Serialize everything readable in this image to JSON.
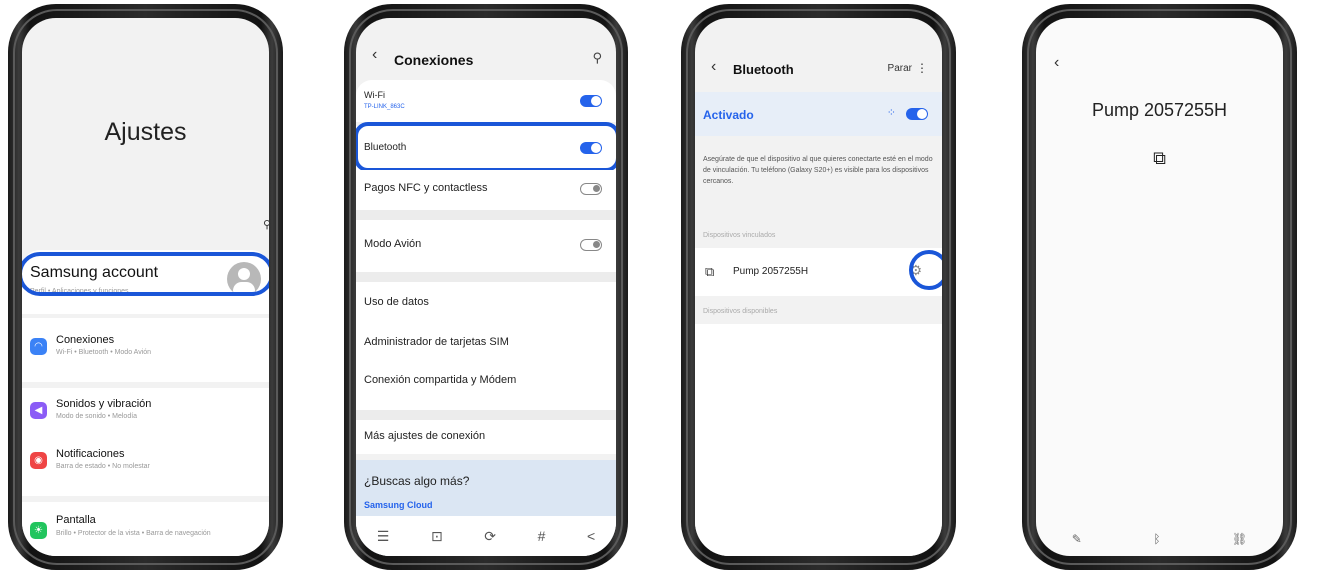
{
  "phone1": {
    "title": "Ajustes",
    "account": {
      "name": "Samsung account",
      "sub": "Perfil • Aplicaciones y funciones"
    },
    "items": [
      {
        "label": "Conexiones",
        "sub": "Wi-Fi • Bluetooth • Modo Avión",
        "color": "#3b82f6",
        "icon": "wifi-icon"
      },
      {
        "label": "Sonidos y vibración",
        "sub": "Modo de sonido • Melodía",
        "color": "#8b5cf6",
        "icon": "speaker-icon"
      },
      {
        "label": "Notificaciones",
        "sub": "Barra de estado • No molestar",
        "color": "#ef4444",
        "icon": "bell-icon"
      },
      {
        "label": "Pantalla",
        "sub": "Brillo • Protector de la vista • Barra de navegación",
        "color": "#22c55e",
        "icon": "sun-icon"
      }
    ]
  },
  "phone2": {
    "title": "Conexiones",
    "wifi": {
      "label": "Wi-Fi",
      "network": "TP-LINK_863C"
    },
    "bluetooth": {
      "label": "Bluetooth"
    },
    "nfc": {
      "label": "Pagos NFC y contactless"
    },
    "airplane": {
      "label": "Modo Avión"
    },
    "data": {
      "label": "Uso de datos"
    },
    "sim": {
      "label": "Administrador de tarjetas SIM"
    },
    "hotspot": {
      "label": "Conexión compartida y Módem"
    },
    "more": {
      "label": "Más ajustes de conexión"
    },
    "suggest": {
      "question": "¿Buscas algo más?",
      "link": "Samsung Cloud"
    }
  },
  "phone3": {
    "title": "Bluetooth",
    "stop": "Parar",
    "status": "Activado",
    "info": "Asegúrate de que el dispositivo al que quieres conectarte esté en el modo de vinculación. Tu teléfono (Galaxy S20+) es visible para los dispositivos cercanos.",
    "paired_header": "Dispositivos vinculados",
    "device": "Pump 2057255H",
    "available_header": "Dispositivos disponibles"
  },
  "phone4": {
    "device": "Pump 2057255H"
  },
  "colors": {
    "accent": "#2563eb",
    "highlight": "#1a56d8"
  }
}
